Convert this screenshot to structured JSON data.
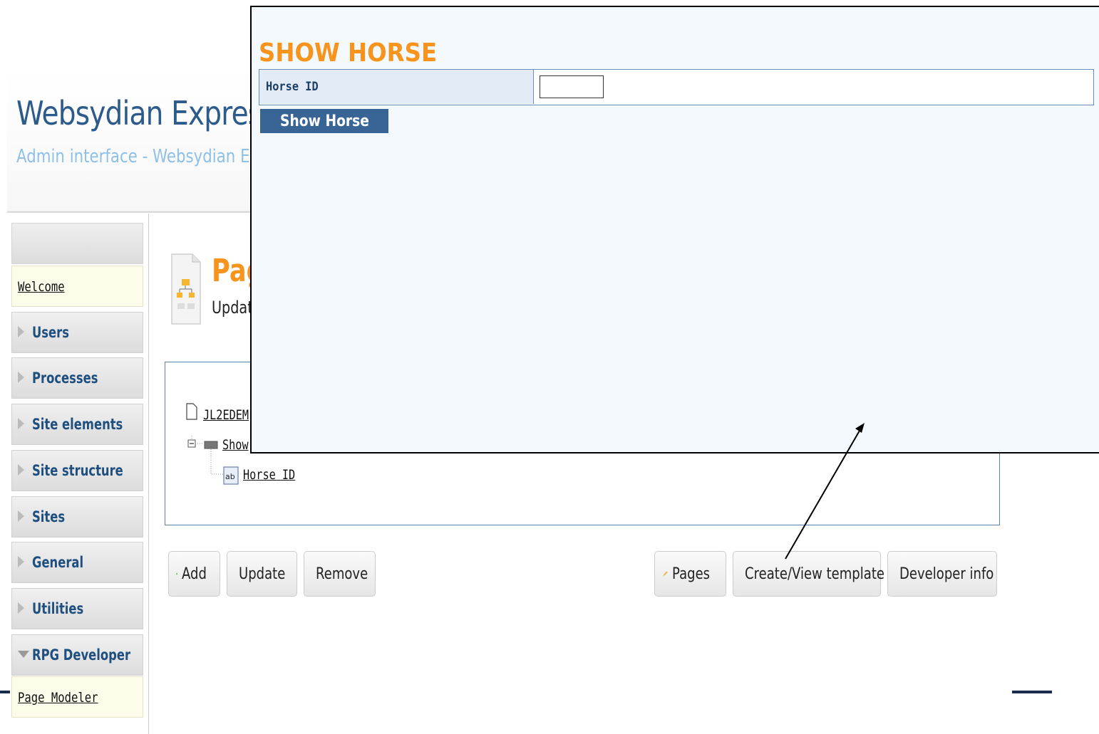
{
  "app": {
    "title": "Websydian Express",
    "subtitle": "Admin interface - Websydian Expre"
  },
  "sidebar": {
    "welcome": "Welcome",
    "items": [
      {
        "label": "Users"
      },
      {
        "label": "Processes"
      },
      {
        "label": "Site elements"
      },
      {
        "label": "Site structure"
      },
      {
        "label": "Sites"
      },
      {
        "label": "General"
      },
      {
        "label": "Utilities"
      },
      {
        "label": "RPG Developer"
      }
    ],
    "sub_link": "Page Modeler"
  },
  "page": {
    "title": "Pag",
    "subtitle": "Updat"
  },
  "tree": {
    "root": "JL2EDEM",
    "child": "Show",
    "leaf": "Horse ID"
  },
  "buttons": {
    "add": "Add",
    "update": "Update",
    "remove": "Remove",
    "pages": "Pages",
    "template": "Create/View template",
    "developer": "Developer info"
  },
  "overlay": {
    "title": "SHOW HORSE",
    "field_label": "Horse ID",
    "field_value": "",
    "button": "Show Horse"
  },
  "colors": {
    "accent_orange": "#f7941d",
    "brand_blue": "#2c5a8a",
    "button_blue": "#386496"
  }
}
